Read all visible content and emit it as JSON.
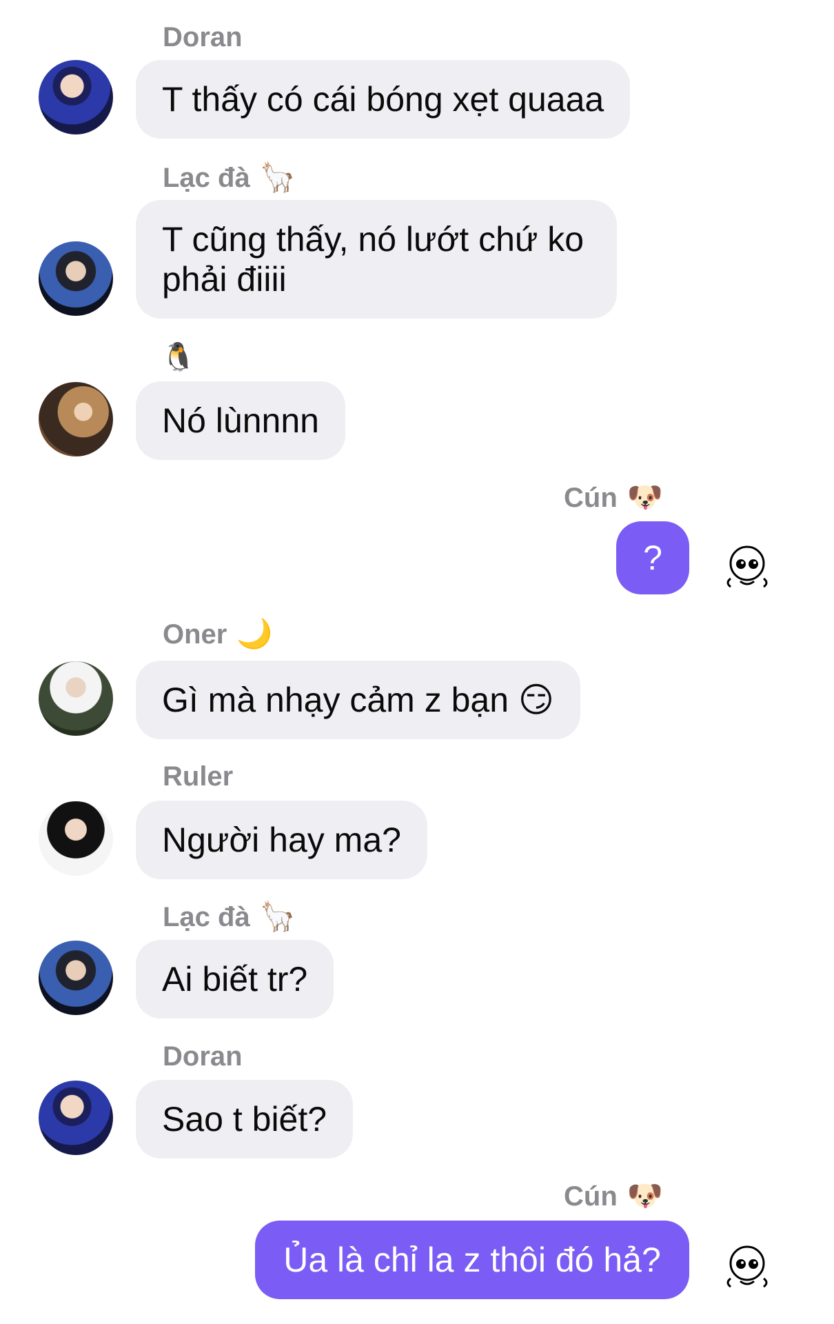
{
  "messages": [
    {
      "sender": "Doran",
      "sender_emoji": "",
      "text": "T thấy có cái bóng xẹt quaaa",
      "mine": false,
      "avatar": "doran-avatar"
    },
    {
      "sender": "Lạc đà",
      "sender_emoji": "🦙",
      "text": "T cũng thấy, nó lướt chứ ko phải điiii",
      "mine": false,
      "avatar": "lac-da-avatar"
    },
    {
      "sender": "",
      "sender_emoji": "🐧",
      "text": "Nó lùnnnn",
      "mine": false,
      "avatar": "penguin-user-avatar"
    },
    {
      "sender": "Cún",
      "sender_emoji": "🐶",
      "text": "?",
      "mine": true,
      "avatar": "skull-sticker"
    },
    {
      "sender": "Oner",
      "sender_emoji": "🌙",
      "text": "Gì mà nhạy cảm z bạn 😏",
      "mine": false,
      "avatar": "oner-avatar"
    },
    {
      "sender": "Ruler",
      "sender_emoji": "",
      "text": "Người hay ma?",
      "mine": false,
      "avatar": "ruler-avatar"
    },
    {
      "sender": "Lạc đà",
      "sender_emoji": "🦙",
      "text": "Ai biết tr?",
      "mine": false,
      "avatar": "lac-da-avatar"
    },
    {
      "sender": "Doran",
      "sender_emoji": "",
      "text": "Sao t biết?",
      "mine": false,
      "avatar": "doran-avatar"
    },
    {
      "sender": "Cún",
      "sender_emoji": "🐶",
      "text": "Ủa là chỉ la z thôi đó hả?",
      "mine": true,
      "avatar": "skull-sticker"
    }
  ],
  "colors": {
    "incoming_bubble": "#efeff3",
    "outgoing_bubble": "#7b5cf5",
    "sender_name": "#8a8a8e"
  }
}
